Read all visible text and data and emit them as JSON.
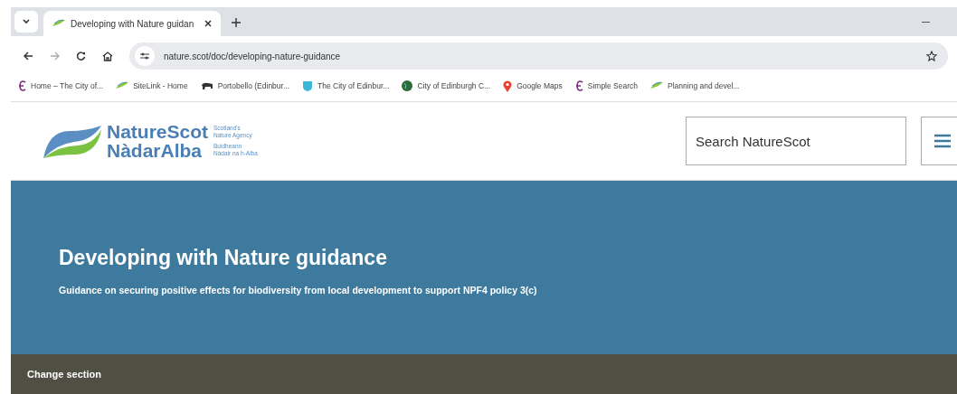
{
  "browser": {
    "tab": {
      "title": "Developing with Nature guidan",
      "selected": true
    },
    "address": "nature.scot/doc/developing-nature-guidance",
    "bookmarks": [
      {
        "kind": "edinburgh",
        "label": "Home – The City of..."
      },
      {
        "kind": "leaf",
        "label": "SiteLink - Home"
      },
      {
        "kind": "bison",
        "label": "Portobello (Edinbur..."
      },
      {
        "kind": "shield",
        "label": "The City of Edinbur..."
      },
      {
        "kind": "globe",
        "label": "City of Edinburgh C..."
      },
      {
        "kind": "pin",
        "label": "Google Maps"
      },
      {
        "kind": "edinburgh",
        "label": "Simple Search"
      },
      {
        "kind": "leaf",
        "label": "Planning and devel..."
      }
    ]
  },
  "header": {
    "logo": {
      "name_en": "NatureScot",
      "name_gd": "NàdarAlba",
      "tagline_en": "Scotland's Nature Agency",
      "tagline_gd": "Buidheann Nàdair na h-Alba"
    },
    "search": {
      "placeholder": "Search NatureScot"
    }
  },
  "hero": {
    "title": "Developing with Nature guidance",
    "subtitle": "Guidance on securing positive effects for biodiversity from local development to support NPF4 policy 3(c)"
  },
  "section_bar": {
    "label": "Change section"
  }
}
